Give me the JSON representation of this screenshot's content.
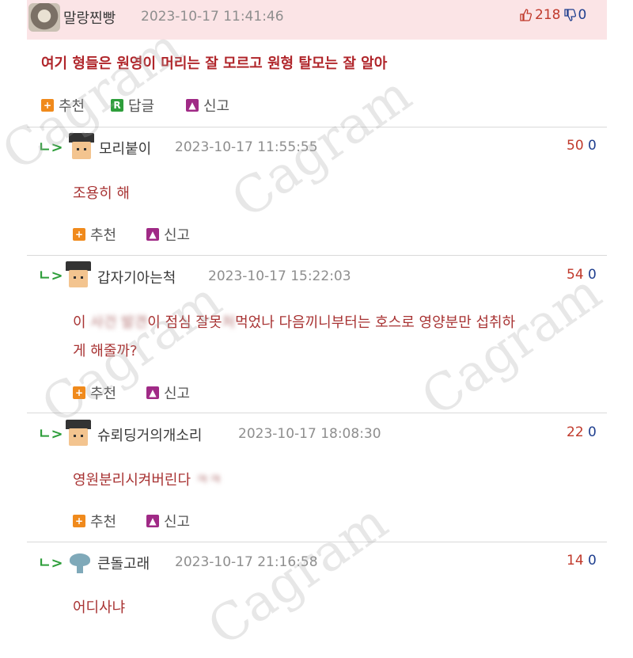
{
  "post": {
    "author": "말랑찐빵",
    "date": "2023-10-17 11:41:46",
    "upvotes": "218",
    "downvotes": "0",
    "body": "여기 형들은 원영이 머리는 잘 모르고 원형 탈모는 잘 알아",
    "actions": {
      "recommend": "추천",
      "reply": "답글",
      "report": "신고"
    }
  },
  "replies": [
    {
      "author": "모리붙이",
      "date": "2023-10-17 11:55:55",
      "score": "50",
      "zero": "0",
      "text_lines": [
        "조용히 해"
      ]
    },
    {
      "author": "갑자기아는척",
      "date": "2023-10-17 15:22:03",
      "score": "54",
      "zero": "0",
      "text_line1_a": "이 ",
      "text_line1_blur": "사건 발견",
      "text_line1_b": "이 점심 잘못",
      "text_line1_blur2": "처",
      "text_line1_c": "먹었나 다음끼니부터는 호스로 영양분만 섭취하",
      "text_line2": "게 해줄까?"
    },
    {
      "author": "슈뢰딩거의개소리",
      "date": "2023-10-17 18:08:30",
      "score": "22",
      "zero": "0",
      "text_a": "영원분리시켜버린다 ",
      "text_blur": "ㅋㅋ"
    },
    {
      "author": "큰돌고래",
      "date": "2023-10-17 21:16:58",
      "score": "14",
      "zero": "0",
      "text_lines": [
        "어디사냐"
      ]
    }
  ],
  "reply_actions": {
    "recommend": "추천",
    "report": "신고"
  },
  "reply_marker": "ㄴ>",
  "watermark": "Cagram",
  "icons": {
    "recommend": "plus-icon",
    "reply": "r-icon",
    "report": "siren-icon",
    "thumbs_up": "thumbs-up-icon",
    "thumbs_down": "thumbs-down-icon"
  },
  "colors": {
    "header_bg": "#fbe4e6",
    "post_text": "#b0262b",
    "reply_text": "#a83333",
    "up": "#c0392b",
    "down": "#1f3f8f"
  }
}
